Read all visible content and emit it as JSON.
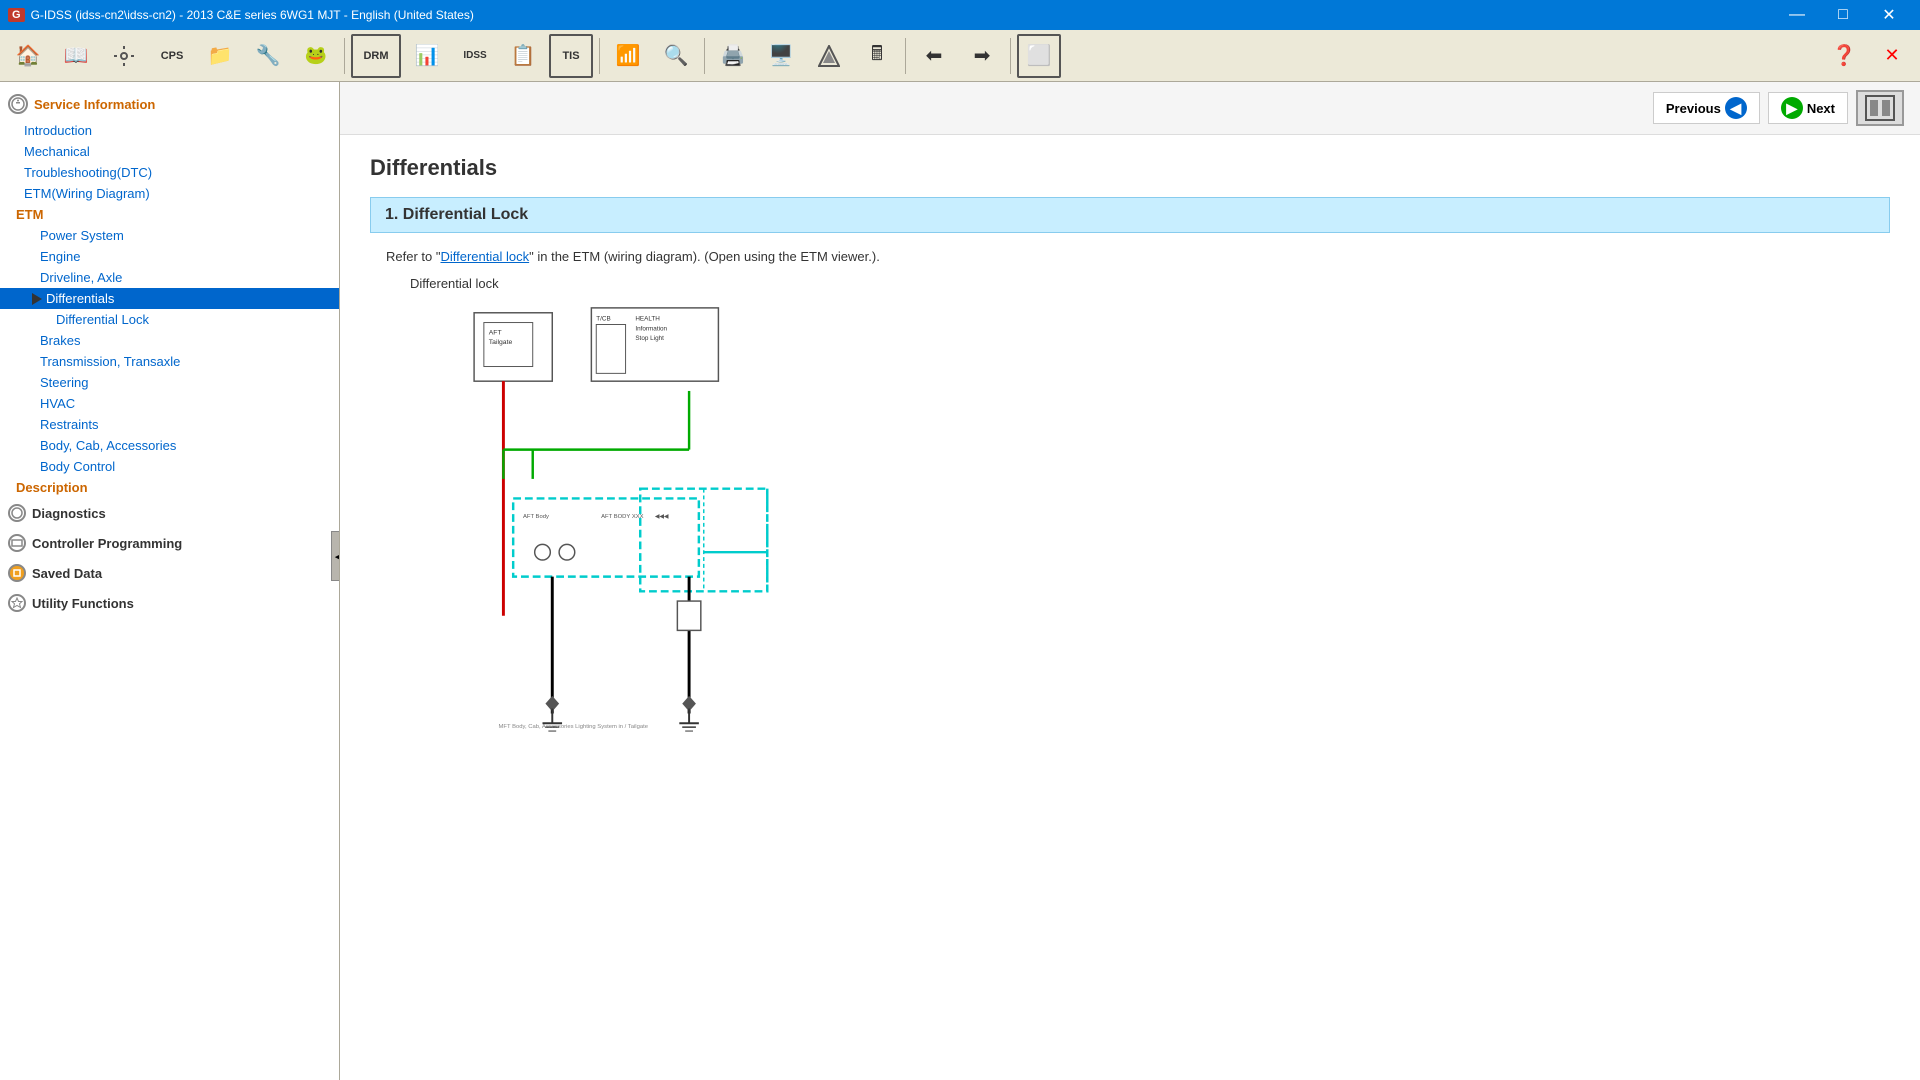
{
  "titlebar": {
    "title": "G-IDSS (idss-cn2\\idss-cn2) - 2013 C&E series 6WG1 MJT - English (United States)",
    "logo": "G-IDSS",
    "minimize": "—",
    "maximize": "□",
    "close": "✕"
  },
  "toolbar": {
    "buttons": [
      {
        "name": "home-btn",
        "icon": "🏠"
      },
      {
        "name": "book-btn",
        "icon": "📖"
      },
      {
        "name": "tools-btn",
        "icon": "⚙️"
      },
      {
        "name": "cps-btn",
        "icon": "CPS"
      },
      {
        "name": "folder-btn",
        "icon": "📁"
      },
      {
        "name": "wrench-btn",
        "icon": "🔧"
      },
      {
        "name": "frog-btn",
        "icon": "🐸"
      },
      {
        "name": "drm-btn",
        "icon": "DRM"
      },
      {
        "name": "chart-btn",
        "icon": "📊"
      },
      {
        "name": "idss-btn",
        "icon": "IDSS"
      },
      {
        "name": "report-btn",
        "icon": "📋"
      },
      {
        "name": "tis-btn",
        "icon": "TIS"
      },
      {
        "name": "signal-btn",
        "icon": "📶"
      },
      {
        "name": "search-btn",
        "icon": "🔍"
      },
      {
        "name": "print-btn",
        "icon": "🖨️"
      },
      {
        "name": "monitor-btn",
        "icon": "🖥️"
      },
      {
        "name": "network-btn",
        "icon": "🌐"
      },
      {
        "name": "calc-btn",
        "icon": "🖩"
      },
      {
        "name": "back-btn",
        "icon": "⬅"
      },
      {
        "name": "forward-btn",
        "icon": "➡"
      },
      {
        "name": "capture-btn",
        "icon": "⬜"
      },
      {
        "name": "help-btn",
        "icon": "❓"
      },
      {
        "name": "exit-btn",
        "icon": "✕"
      }
    ]
  },
  "sidebar": {
    "service_information_label": "Service Information",
    "introduction_label": "Introduction",
    "mechanical_label": "Mechanical",
    "troubleshooting_label": "Troubleshooting(DTC)",
    "etm_label": "ETM(Wiring Diagram)",
    "etm_sub_label": "ETM",
    "power_system_label": "Power System",
    "engine_label": "Engine",
    "driveline_label": "Driveline, Axle",
    "differentials_label": "Differentials",
    "differential_lock_label": "Differential Lock",
    "brakes_label": "Brakes",
    "transmission_label": "Transmission, Transaxle",
    "steering_label": "Steering",
    "hvac_label": "HVAC",
    "restraints_label": "Restraints",
    "body_cab_label": "Body, Cab, Accessories",
    "body_control_label": "Body Control",
    "description_label": "Description",
    "diagnostics_label": "Diagnostics",
    "controller_label": "Controller Programming",
    "saveddata_label": "Saved Data",
    "utility_label": "Utility Functions"
  },
  "content": {
    "page_title": "Differentials",
    "section_number": "1.",
    "section_title": "Differential Lock",
    "refer_text": "Refer to ",
    "link_text": "Differential lock",
    "refer_suffix": " in the ETM (wiring diagram). (Open using the ETM viewer.).",
    "diagram_label": "Differential lock",
    "diagram_caption": "MFT Body, Cab, Accessories Lighting System in / Tailgate"
  },
  "nav_buttons": {
    "previous_label": "Previous",
    "next_label": "Next"
  }
}
